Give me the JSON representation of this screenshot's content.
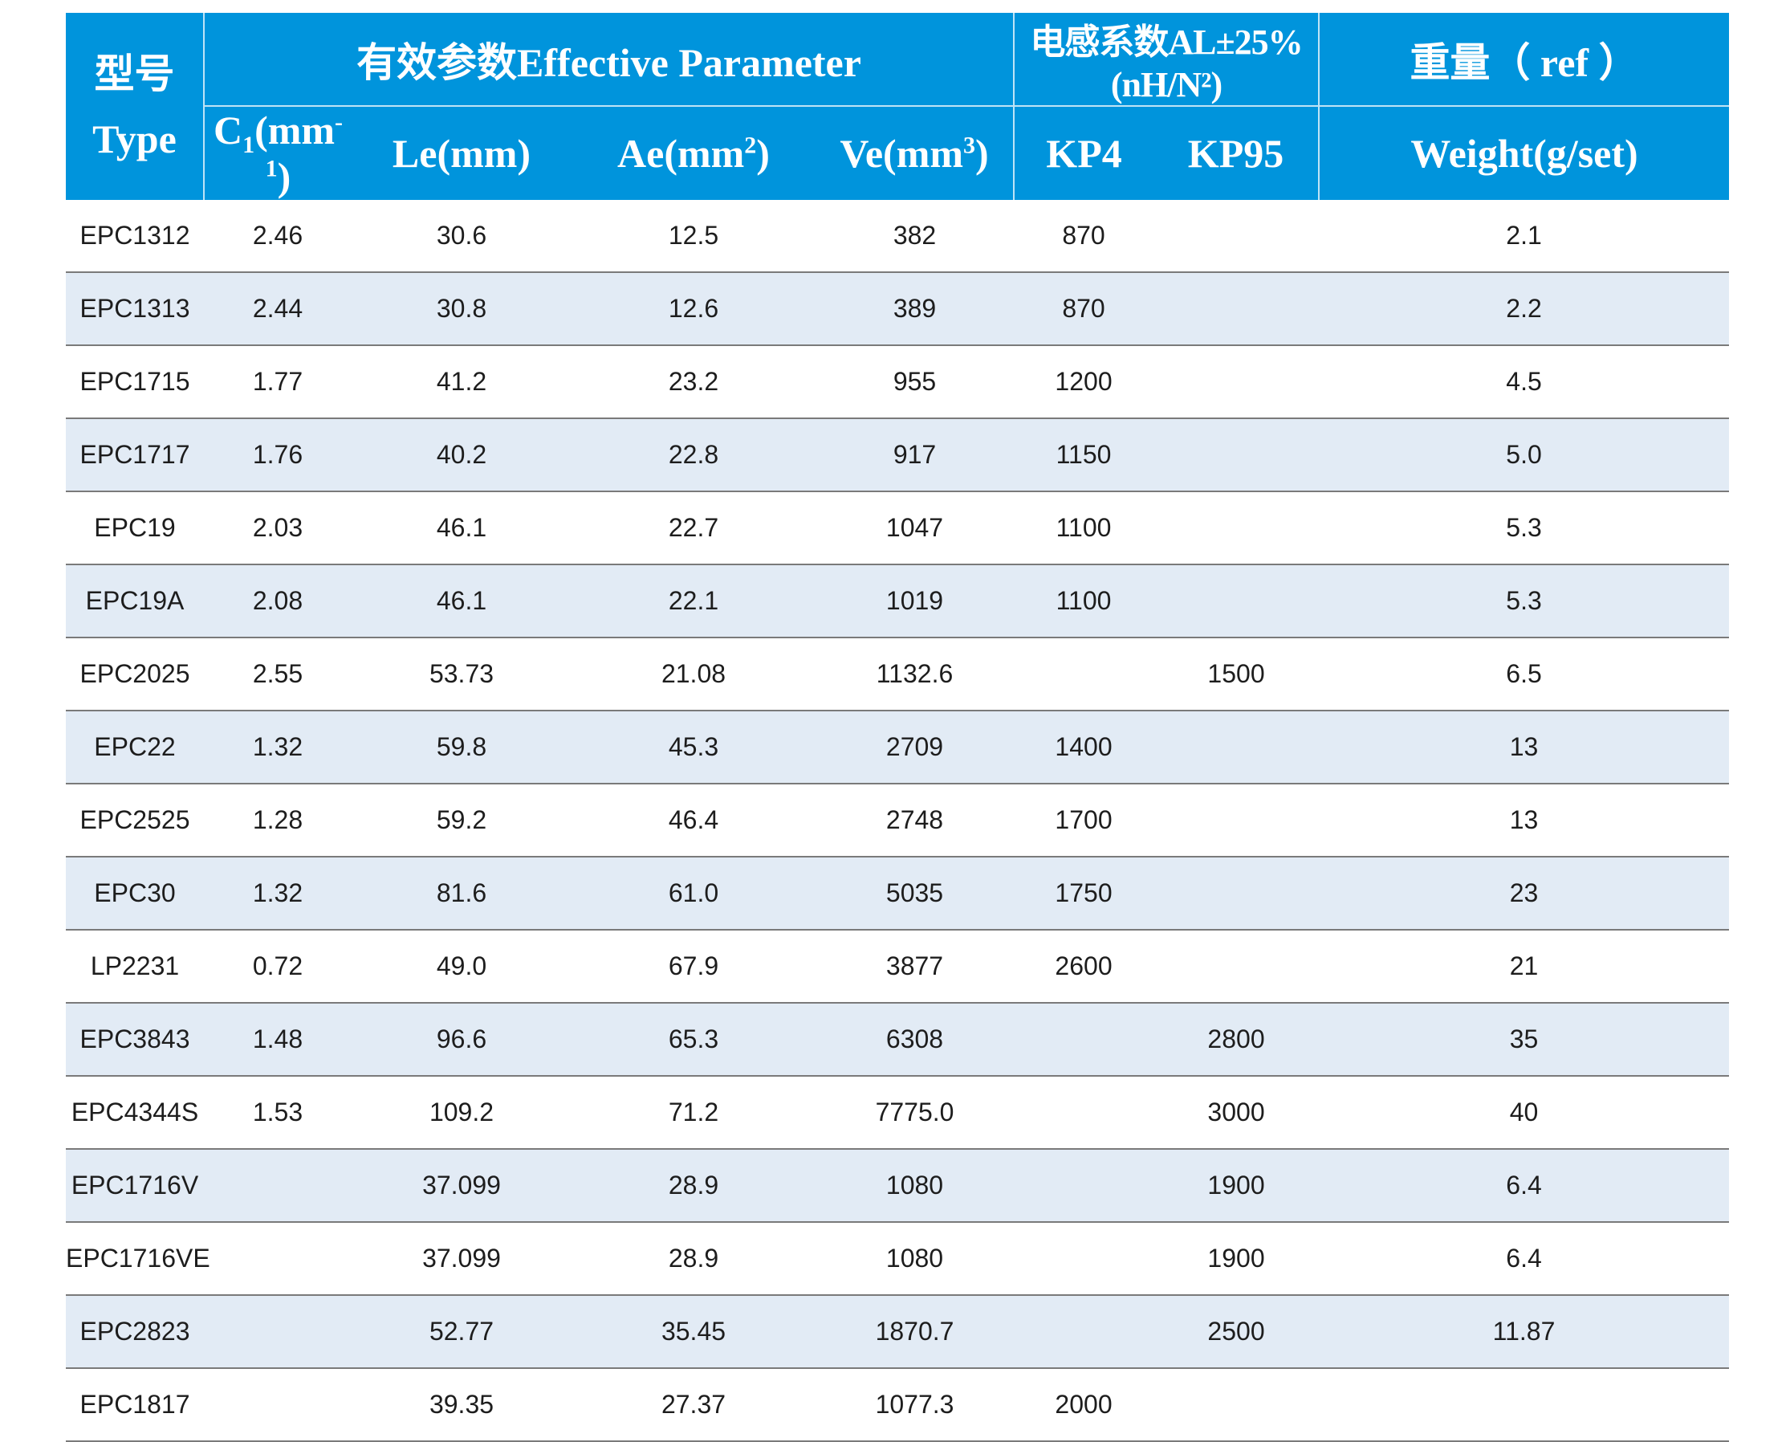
{
  "header": {
    "type_zh": "型号",
    "type_en": "Type",
    "effective_title": "有效参数Effective Parameter",
    "al_title": "电感系数AL±25%(nH/N²)",
    "weight_title": "重量（ ref ）",
    "c1_label": "C",
    "c1_sub": "1",
    "c1_unit_pre": "(mm",
    "c1_sup": "-1",
    "c1_unit_post": ")",
    "le_label": "Le(mm)",
    "ae_label": "Ae(mm",
    "ae_sup": "2",
    "ae_post": ")",
    "ve_label": "Ve(mm",
    "ve_sup": "3",
    "ve_post": ")",
    "kp4_label": "KP4",
    "kp95_label": "KP95",
    "weight_label": "Weight(g/set)"
  },
  "rows": [
    {
      "type": "EPC1312",
      "c1": "2.46",
      "le": "30.6",
      "ae": "12.5",
      "ve": "382",
      "kp4": "870",
      "kp95": "",
      "weight": "2.1"
    },
    {
      "type": "EPC1313",
      "c1": "2.44",
      "le": "30.8",
      "ae": "12.6",
      "ve": "389",
      "kp4": "870",
      "kp95": "",
      "weight": "2.2"
    },
    {
      "type": "EPC1715",
      "c1": "1.77",
      "le": "41.2",
      "ae": "23.2",
      "ve": "955",
      "kp4": "1200",
      "kp95": "",
      "weight": "4.5"
    },
    {
      "type": "EPC1717",
      "c1": "1.76",
      "le": "40.2",
      "ae": "22.8",
      "ve": "917",
      "kp4": "1150",
      "kp95": "",
      "weight": "5.0"
    },
    {
      "type": "EPC19",
      "c1": "2.03",
      "le": "46.1",
      "ae": "22.7",
      "ve": "1047",
      "kp4": "1100",
      "kp95": "",
      "weight": "5.3"
    },
    {
      "type": "EPC19A",
      "c1": "2.08",
      "le": "46.1",
      "ae": "22.1",
      "ve": "1019",
      "kp4": "1100",
      "kp95": "",
      "weight": "5.3"
    },
    {
      "type": "EPC2025",
      "c1": "2.55",
      "le": "53.73",
      "ae": "21.08",
      "ve": "1132.6",
      "kp4": "",
      "kp95": "1500",
      "weight": "6.5"
    },
    {
      "type": "EPC22",
      "c1": "1.32",
      "le": "59.8",
      "ae": "45.3",
      "ve": "2709",
      "kp4": "1400",
      "kp95": "",
      "weight": "13"
    },
    {
      "type": "EPC2525",
      "c1": "1.28",
      "le": "59.2",
      "ae": "46.4",
      "ve": "2748",
      "kp4": "1700",
      "kp95": "",
      "weight": "13"
    },
    {
      "type": "EPC30",
      "c1": "1.32",
      "le": "81.6",
      "ae": "61.0",
      "ve": "5035",
      "kp4": "1750",
      "kp95": "",
      "weight": "23"
    },
    {
      "type": "LP2231",
      "c1": "0.72",
      "le": "49.0",
      "ae": "67.9",
      "ve": "3877",
      "kp4": "2600",
      "kp95": "",
      "weight": "21"
    },
    {
      "type": "EPC3843",
      "c1": "1.48",
      "le": "96.6",
      "ae": "65.3",
      "ve": "6308",
      "kp4": "",
      "kp95": "2800",
      "weight": "35"
    },
    {
      "type": "EPC4344S",
      "c1": "1.53",
      "le": "109.2",
      "ae": "71.2",
      "ve": "7775.0",
      "kp4": "",
      "kp95": "3000",
      "weight": "40"
    },
    {
      "type": "EPC1716V",
      "c1": "",
      "le": "37.099",
      "ae": "28.9",
      "ve": "1080",
      "kp4": "",
      "kp95": "1900",
      "weight": "6.4"
    },
    {
      "type": "EPC1716VE",
      "c1": "",
      "le": "37.099",
      "ae": "28.9",
      "ve": "1080",
      "kp4": "",
      "kp95": "1900",
      "weight": "6.4"
    },
    {
      "type": "EPC2823",
      "c1": "",
      "le": "52.77",
      "ae": "35.45",
      "ve": "1870.7",
      "kp4": "",
      "kp95": "2500",
      "weight": "11.87"
    },
    {
      "type": "EPC1817",
      "c1": "",
      "le": "39.35",
      "ae": "27.37",
      "ve": "1077.3",
      "kp4": "2000",
      "kp95": "",
      "weight": ""
    }
  ],
  "colors": {
    "header_bg": "#0094dc",
    "header_text": "#ffffff",
    "stripe_bg": "#e2ebf5",
    "row_border": "#7a7a7a",
    "cell_text": "#1d1d1d"
  }
}
